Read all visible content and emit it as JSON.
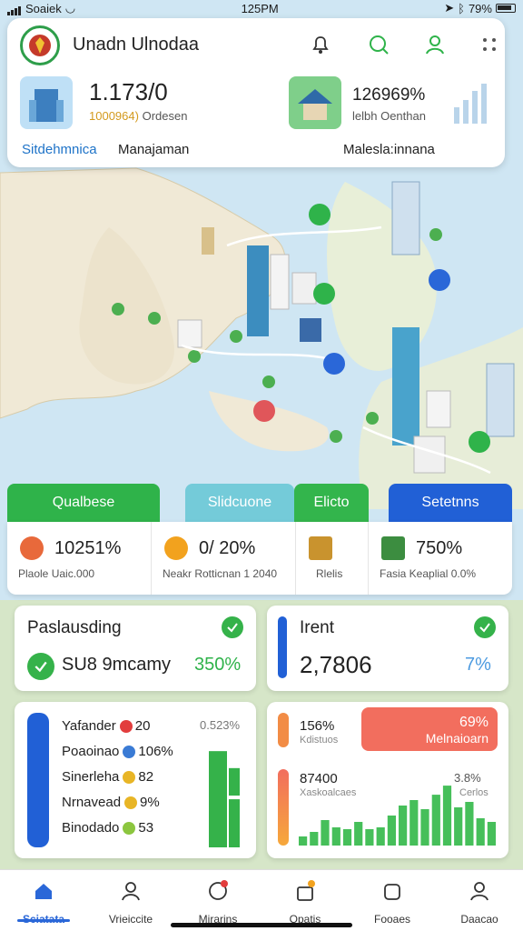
{
  "status_bar": {
    "carrier": "Soaiek",
    "time": "125PM",
    "battery": "79%"
  },
  "header": {
    "title": "Unadn Ulnodaa",
    "stat_left": {
      "value": "1.173/0",
      "sub_amber": "1000964)",
      "sub_rest": "Ordesen"
    },
    "stat_right": {
      "value": "126969%",
      "sub": "lelbh Oenthan"
    },
    "link_left": "Sitdehmnica",
    "link_mid": "Manajaman",
    "link_right": "Malesla:innana"
  },
  "tabs": [
    {
      "label": "Qualbese",
      "color": "#2fb34a"
    },
    {
      "label": "Slidcuone",
      "color": "#74cbd9"
    },
    {
      "label": "Elicto",
      "color": "#33b54c"
    },
    {
      "label": "Setetnns",
      "color": "#2160d6"
    }
  ],
  "strip": [
    {
      "icon": "orange-dot-icon",
      "value": "10251%",
      "sub": "Plaole  Uaic.000",
      "color": "#e8693b"
    },
    {
      "icon": "sun-icon",
      "value": "0/ 20%",
      "sub": "Neakr    Rotticnan 1 2040",
      "color": "#f2a21e"
    },
    {
      "icon": "shop-icon",
      "value": "",
      "sub": "Rlelis",
      "color": "#c9932e"
    },
    {
      "icon": "chart-icon",
      "value": "750%",
      "sub": "Fasia    Keaplial 0.0%",
      "color": "#3c8d40"
    }
  ],
  "card_a": {
    "title": "Paslausding",
    "value": "SU8 9mcamy",
    "percent": "350%"
  },
  "card_b": {
    "title": "Irent",
    "value": "2,7806",
    "percent": "7%"
  },
  "card_c": {
    "side_value": "0.523%",
    "rows": [
      {
        "label": "Yafander",
        "value": "20",
        "dot": "#e23d3d"
      },
      {
        "label": "Poaoinao",
        "value": "106%",
        "dot": "#3a7bd5"
      },
      {
        "label": "Sinerleha",
        "value": "82",
        "dot": "#e8b526"
      },
      {
        "label": "Nrnavead",
        "value": "9%",
        "dot": "#e8b526"
      },
      {
        "label": "Binodado",
        "value": "53",
        "dot": "#8cc63f"
      }
    ],
    "bars": [
      0.84,
      0.24,
      0.42
    ]
  },
  "card_d": {
    "top_value": "156%",
    "top_sub": "Kdistuos",
    "badge_value": "69%",
    "badge_label": "Melnaioarn",
    "mid_value": "87400",
    "mid_sub": "Xaskoalcaes",
    "right_value": "3.8%",
    "right_sub": "Cerlos",
    "bars": [
      0.1,
      0.15,
      0.28,
      0.2,
      0.18,
      0.26,
      0.18,
      0.2,
      0.33,
      0.44,
      0.5,
      0.4,
      0.56,
      0.66,
      0.42,
      0.48,
      0.3,
      0.26
    ]
  },
  "nav": [
    {
      "label": "Sciatata",
      "icon": "home-icon",
      "active": true
    },
    {
      "label": "Vrieiccite",
      "icon": "people-icon",
      "active": false
    },
    {
      "label": "Mirarins",
      "icon": "chat-icon",
      "active": false
    },
    {
      "label": "Opatis",
      "icon": "bag-icon",
      "active": false
    },
    {
      "label": "Fooaes",
      "icon": "box-icon",
      "active": false
    },
    {
      "label": "Daacao",
      "icon": "person-icon",
      "active": false
    }
  ]
}
